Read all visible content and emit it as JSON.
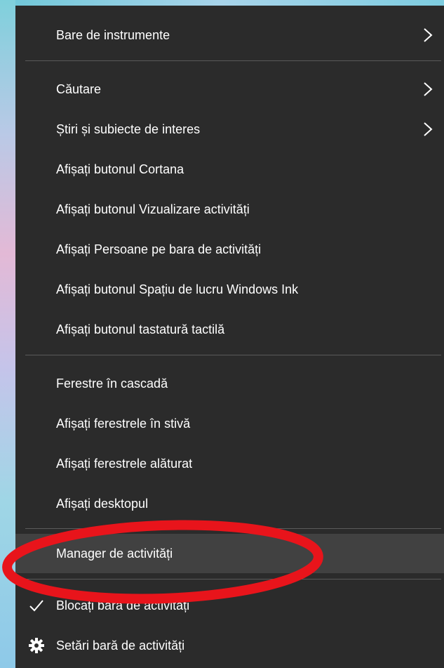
{
  "menu": {
    "items": [
      {
        "label": "Bare de instrumente",
        "submenu": true
      },
      {
        "label": "Căutare",
        "submenu": true
      },
      {
        "label": "Știri și subiecte de interes",
        "submenu": true
      },
      {
        "label": "Afișați butonul Cortana"
      },
      {
        "label": "Afișați butonul Vizualizare activități"
      },
      {
        "label": "Afișați Persoane pe bara de activități"
      },
      {
        "label": "Afișați butonul Spațiu de lucru Windows Ink"
      },
      {
        "label": "Afișați butonul tastatură tactilă"
      },
      {
        "label": "Ferestre în cascadă"
      },
      {
        "label": "Afișați ferestrele în stivă"
      },
      {
        "label": "Afișați ferestrele alăturat"
      },
      {
        "label": "Afișați desktopul"
      },
      {
        "label": "Manager de activități",
        "highlighted": true
      },
      {
        "label": "Blocați bara de activități",
        "checked": true,
        "icon": "checkmark-icon"
      },
      {
        "label": "Setări bară de activități",
        "icon": "gear-icon"
      }
    ]
  },
  "annotation": {
    "shape": "ellipse",
    "color": "#e8141b"
  },
  "colors": {
    "menu_bg": "#2b2b2b",
    "hover_bg": "#414141",
    "text": "#ffffff",
    "separator": "#5a5a5a"
  }
}
